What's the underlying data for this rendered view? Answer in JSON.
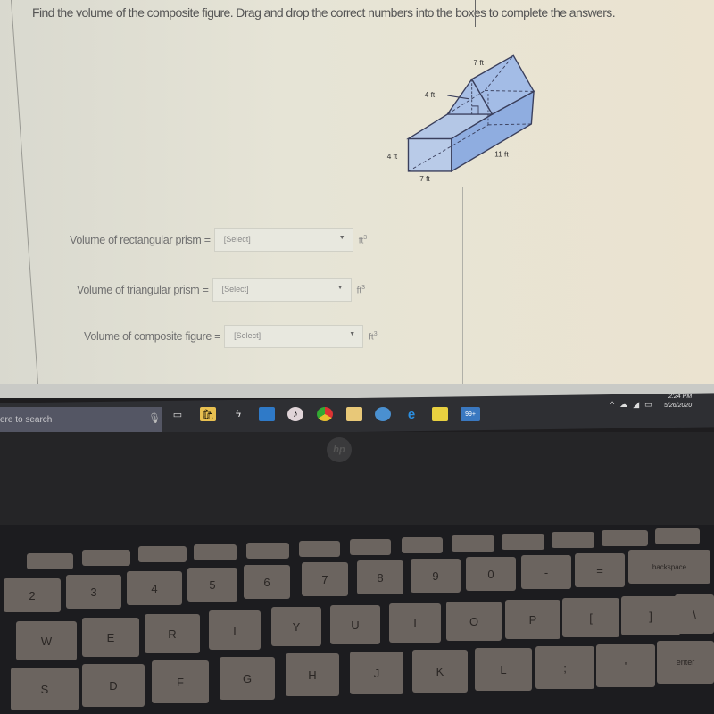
{
  "question": {
    "text": "Find the volume of the composite figure. Drag and drop the correct numbers into the boxes to complete the answers."
  },
  "figure": {
    "labels": {
      "prism_top_length": "7 ft",
      "triangle_height": "4 ft",
      "rect_height": "4 ft",
      "rect_width": "7 ft",
      "rect_length": "11 ft"
    },
    "colors": {
      "fill": "#9fb8e6",
      "stroke": "#3a3f5c"
    }
  },
  "answers": [
    {
      "label": "Volume of rectangular prism =",
      "placeholder": "[Select]",
      "unit": "ft",
      "unit_exp": "3"
    },
    {
      "label": "Volume of triangular prism =",
      "placeholder": "[Select]",
      "unit": "ft",
      "unit_exp": "3"
    },
    {
      "label": "Volume of composite figure =",
      "placeholder": "[Select]",
      "unit": "ft",
      "unit_exp": "3"
    }
  ],
  "taskbar": {
    "search_placeholder": "ere to search",
    "apps": [
      "task-view",
      "store",
      "winamp",
      "photos",
      "itunes",
      "chrome",
      "file-explorer",
      "edge-old",
      "edge",
      "sticky-notes",
      "mail"
    ],
    "mail_badge": "99+",
    "clock_time": "2:24 PM",
    "clock_date": "5/26/2020"
  },
  "laptop": {
    "brand": "hp"
  },
  "keyboard": {
    "row_numbers": [
      "2",
      "3",
      "4",
      "5",
      "6",
      "7",
      "8",
      "9",
      "0",
      "-",
      "=",
      "backspace"
    ],
    "row_top": [
      "W",
      "E",
      "R",
      "T",
      "Y",
      "U",
      "I",
      "O",
      "P",
      "[",
      "]",
      "\\"
    ],
    "row_home": [
      "S",
      "D",
      "F",
      "G",
      "H",
      "J",
      "K",
      "L",
      ";",
      "'",
      "enter"
    ]
  }
}
